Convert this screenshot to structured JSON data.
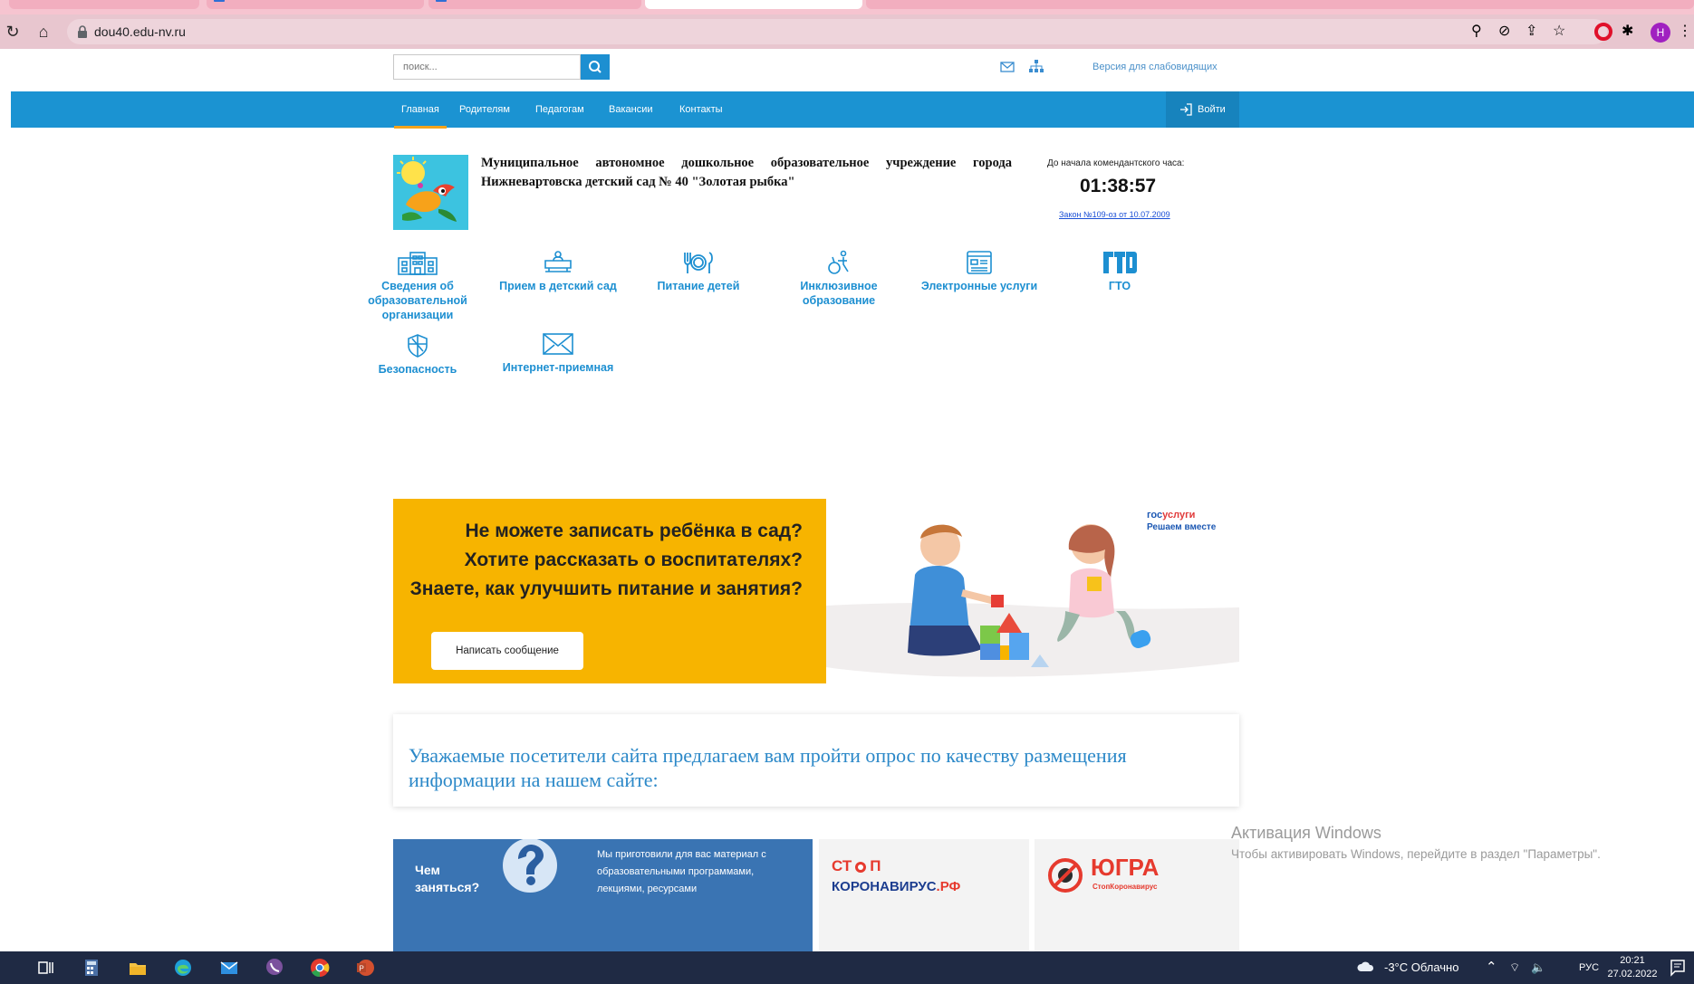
{
  "browser": {
    "url": "dou40.edu-nv.ru",
    "profile_initial": "Н"
  },
  "header": {
    "search_placeholder": "поиск...",
    "low_vision_link": "Версия для слабовидящих"
  },
  "nav": {
    "items": [
      "Главная",
      "Родителям",
      "Педагогам",
      "Вакансии",
      "Контакты"
    ],
    "login": "Войти"
  },
  "org": {
    "name": "Муниципальное автономное дошкольное образовательное учреждение города Нижневартовска детский сад № 40 \"Золотая рыбка\""
  },
  "curfew": {
    "caption": "До начала комендантского часа:",
    "time": "01:38:57",
    "law": "Закон №109-оз от 10.07.2009"
  },
  "quick_links": [
    {
      "label": "Сведения об образовательной организации",
      "icon": "building-icon"
    },
    {
      "label": "Прием в детский сад",
      "icon": "stroller-icon"
    },
    {
      "label": "Питание детей",
      "icon": "cutlery-icon"
    },
    {
      "label": "Инклюзивное образование",
      "icon": "inclusion-icon"
    },
    {
      "label": "Электронные услуги",
      "icon": "eservice-icon"
    },
    {
      "label": "ГТО",
      "icon": "gto-icon"
    },
    {
      "label": "Безопасность",
      "icon": "shield-icon"
    },
    {
      "label": "Интернет-приемная",
      "icon": "envelope-icon"
    }
  ],
  "promo": {
    "text": "Не можете записать ребёнка в сад? Хотите рассказать о воспитателях? Знаете, как улучшить питание и занятия?",
    "button": "Написать сообщение",
    "gos_brand_1": "гос",
    "gos_brand_2": "услуги",
    "gos_tagline": "Решаем вместе"
  },
  "survey": {
    "text": "Уважаемые посетители сайта предлагаем вам пройти опрос по качеству размещения информации на нашем сайте:"
  },
  "banners": {
    "what_to_do_1": "Чем",
    "what_to_do_2": "заняться?",
    "what_to_do_desc": "Мы приготовили для вас материал с образовательными программами, лекциями, ресурсами",
    "stop_corona_1": "СТ",
    "stop_corona_2": "П",
    "stop_corona_3": "КОРОНАВИРУС",
    "stop_corona_4": ".РФ",
    "yugra": "ЮГРА",
    "yugra_sub": "СтопКоронавирус"
  },
  "watermark": {
    "title": "Активация Windows",
    "subtitle": "Чтобы активировать Windows, перейдите в раздел \"Параметры\"."
  },
  "taskbar": {
    "weather": "-3°C  Облачно",
    "lang": "РУС",
    "time": "20:21",
    "date": "27.02.2022"
  },
  "colors": {
    "nav_blue": "#1b93d2",
    "promo_yellow": "#f7b400",
    "link_blue": "#1d8fd1"
  }
}
